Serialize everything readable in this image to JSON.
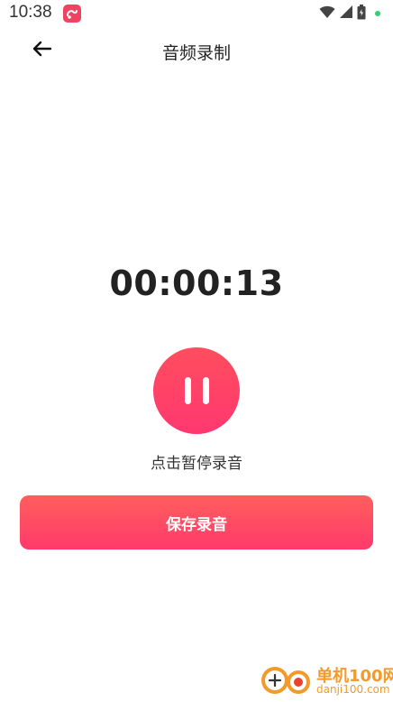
{
  "status_bar": {
    "time": "10:38",
    "icons": [
      "app-notification-icon",
      "wifi-icon",
      "cellular-signal-icon",
      "battery-icon",
      "status-dot"
    ]
  },
  "header": {
    "back_icon": "arrow-left-icon",
    "title": "音频录制"
  },
  "recorder": {
    "timer": "00:00:13",
    "pause_icon": "pause-icon",
    "hint": "点击暂停录音"
  },
  "actions": {
    "save_label": "保存录音"
  },
  "watermark": {
    "name": "单机100网",
    "url": "danji100.com"
  },
  "colors": {
    "accent_start": "#ff5f5d",
    "accent_end": "#ff3a6b",
    "status_dot": "#2ed36b",
    "watermark": "#f39a2c"
  }
}
